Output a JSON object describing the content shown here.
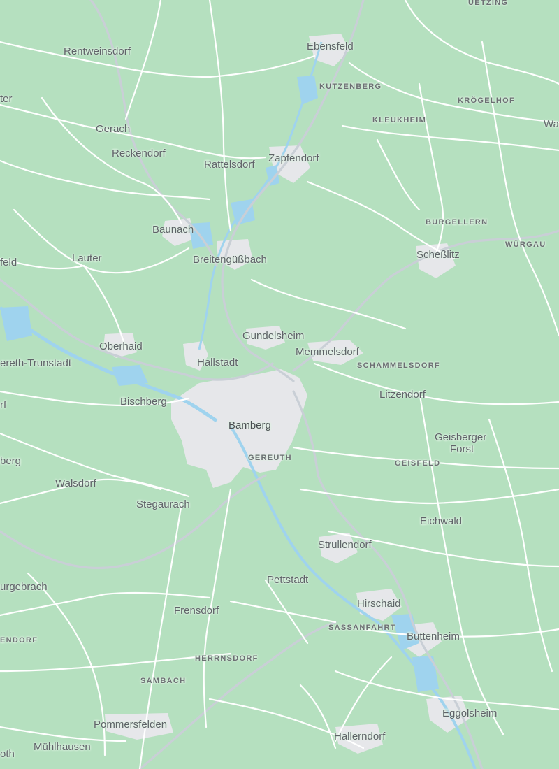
{
  "map": {
    "colors": {
      "land": "#b5e0bf",
      "road": "#ffffff",
      "major_road": "#c9cfd6",
      "urban": "#e6e7ea",
      "water": "#9fd3ee"
    },
    "places": {
      "uetzing": "UETZING",
      "ebensfeld": "Ebensfeld",
      "rentweinsdorf": "Rentweinsdorf",
      "kutzenberg": "KUTZENBERG",
      "kroegelhof": "KRÖGELHOF",
      "kleukheim": "KLEUKHEIM",
      "ter": "ter",
      "wa": "Wa",
      "gerach": "Gerach",
      "reckendorf": "Reckendorf",
      "rattelsdorf": "Rattelsdorf",
      "zapfendorf": "Zapfendorf",
      "burgellern": "BURGELLERN",
      "baunach": "Baunach",
      "wuergau": "WÜRGAU",
      "feld": "feld",
      "lauter": "Lauter",
      "breitenguessbach": "Breitengüßbach",
      "schesslitz": "Scheßlitz",
      "gundelsheim": "Gundelsheim",
      "oberhaid": "Oberhaid",
      "memmelsdorf": "Memmelsdorf",
      "ereth_trunstadt": "ereth-Trunstadt",
      "hallstadt": "Hallstadt",
      "schammelsdorf": "SCHAMMELSDORF",
      "rf": "rf",
      "bischberg": "Bischberg",
      "litzendorf": "Litzendorf",
      "bamberg": "Bamberg",
      "geisberger_forst_1": "Geisberger",
      "geisberger_forst_2": "Forst",
      "berg": "berg",
      "gereuth": "GEREUTH",
      "geisfeld": "GEISFELD",
      "walsdorf": "Walsdorf",
      "stegaurach": "Stegaurach",
      "eichwald": "Eichwald",
      "strullendorf": "Strullendorf",
      "pettstadt": "Pettstadt",
      "urgebrach": "urgebrach",
      "hirschaid": "Hirschaid",
      "frensdorf": "Frensdorf",
      "sassanfahrt": "SASSANFAHRT",
      "buttenheim": "Buttenheim",
      "endorf": "ENDORF",
      "herrnsdorf": "HERRNSDORF",
      "sambach": "SAMBACH",
      "pommersfelden": "Pommersfelden",
      "eggolsheim": "Eggolsheim",
      "hallerndorf": "Hallerndorf",
      "oth": "oth",
      "muehlhausen": "Mühlhausen"
    }
  }
}
